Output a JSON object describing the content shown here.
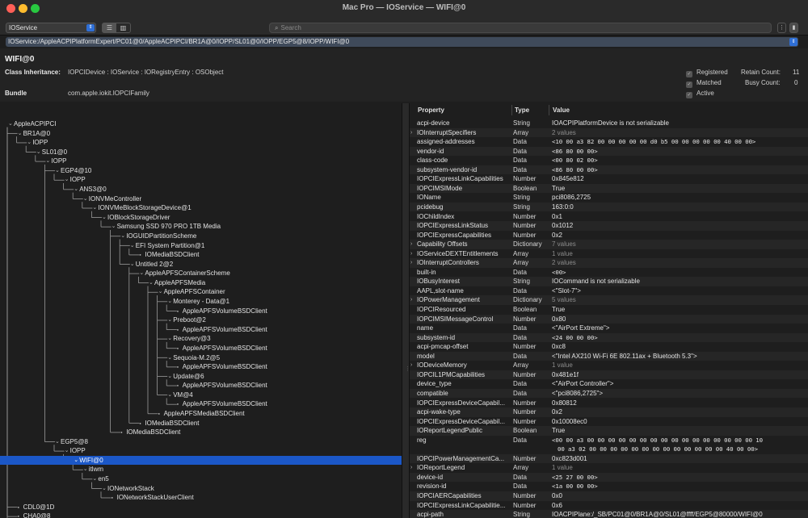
{
  "window": {
    "title": "Mac Pro — IOService — WIFI@0"
  },
  "toolbar": {
    "plane": "IOService",
    "search_placeholder": "Search"
  },
  "path": "IOService:/AppleACPIPlatformExpert/PC01@0/AppleACPIPCI/BR1A@0/IOPP/SL01@0/IOPP/EGP5@8/IOPP/WIFI@0",
  "info": {
    "name": "WIFI@0",
    "class_label": "Class Inheritance:",
    "class_value": "IOPCIDevice : IOService : IORegistryEntry : OSObject",
    "bundle_label": "Bundle",
    "bundle_value": "com.apple.iokit.IOPCIFamily",
    "registered": "Registered",
    "matched": "Matched",
    "active": "Active",
    "retain_label": "Retain Count:",
    "retain_value": "11",
    "busy_label": "Busy Count:",
    "busy_value": "0"
  },
  "tree": [
    {
      "label": "AppleACPIPCI",
      "depth": 0
    },
    {
      "label": "BR1A@0",
      "depth": 1
    },
    {
      "label": "IOPP",
      "depth": 2
    },
    {
      "label": "SL01@0",
      "depth": 3
    },
    {
      "label": "IOPP",
      "depth": 4
    },
    {
      "label": "EGP4@10",
      "depth": 5
    },
    {
      "label": "IOPP",
      "depth": 6
    },
    {
      "label": "ANS3@0",
      "depth": 7
    },
    {
      "label": "IONVMeController",
      "depth": 8
    },
    {
      "label": "IONVMeBlockStorageDevice@1",
      "depth": 9
    },
    {
      "label": "IOBlockStorageDriver",
      "depth": 10
    },
    {
      "label": "Samsung SSD 970 PRO 1TB Media",
      "depth": 11
    },
    {
      "label": "IOGUIDPartitionScheme",
      "depth": 12
    },
    {
      "label": "EFI System Partition@1",
      "depth": 13
    },
    {
      "label": "IOMediaBSDClient",
      "depth": 14
    },
    {
      "label": "Untitled 2@2",
      "depth": 13
    },
    {
      "label": "AppleAPFSContainerScheme",
      "depth": 14
    },
    {
      "label": "AppleAPFSMedia",
      "depth": 15
    },
    {
      "label": "AppleAPFSContainer",
      "depth": 16
    },
    {
      "label": "Monterey - Data@1",
      "depth": 17
    },
    {
      "label": "AppleAPFSVolumeBSDClient",
      "depth": 18
    },
    {
      "label": "Preboot@2",
      "depth": 17
    },
    {
      "label": "AppleAPFSVolumeBSDClient",
      "depth": 18
    },
    {
      "label": "Recovery@3",
      "depth": 17
    },
    {
      "label": "AppleAPFSVolumeBSDClient",
      "depth": 18
    },
    {
      "label": "Sequoia-M.2@5",
      "depth": 17
    },
    {
      "label": "AppleAPFSVolumeBSDClient",
      "depth": 18
    },
    {
      "label": "Update@6",
      "depth": 17
    },
    {
      "label": "AppleAPFSVolumeBSDClient",
      "depth": 18
    },
    {
      "label": "VM@4",
      "depth": 17
    },
    {
      "label": "AppleAPFSVolumeBSDClient",
      "depth": 18
    },
    {
      "label": "AppleAPFSMediaBSDClient",
      "depth": 16
    },
    {
      "label": "IOMediaBSDClient",
      "depth": 14
    },
    {
      "label": "IOMediaBSDClient",
      "depth": 12
    },
    {
      "label": "EGP5@8",
      "depth": 5
    },
    {
      "label": "IOPP",
      "depth": 6
    },
    {
      "label": "WIFI@0",
      "depth": 7,
      "selected": true
    },
    {
      "label": "itlwm",
      "depth": 8
    },
    {
      "label": "en5",
      "depth": 9
    },
    {
      "label": "IONetworkStack",
      "depth": 10
    },
    {
      "label": "IONetworkStackUserClient",
      "depth": 11
    },
    {
      "label": "CDL0@1D",
      "depth": 1
    },
    {
      "label": "CHA0@8",
      "depth": 1
    }
  ],
  "props": {
    "headers": {
      "property": "Property",
      "type": "Type",
      "value": "Value"
    },
    "rows": [
      {
        "k": "acpi-device",
        "t": "String",
        "v": "IOACPIPlatformDevice is not serializable"
      },
      {
        "k": "IOInterruptSpecifiers",
        "t": "Array",
        "v": "2 values",
        "exp": true,
        "dim": true
      },
      {
        "k": "assigned-addresses",
        "t": "Data",
        "v": "<10 00 a3 82 00 00 00 00 00 d0 b5 00 00 00 00 00 40 00 00>",
        "mono": true
      },
      {
        "k": "vendor-id",
        "t": "Data",
        "v": "<86 80 00 00>",
        "mono": true
      },
      {
        "k": "class-code",
        "t": "Data",
        "v": "<00 80 02 00>",
        "mono": true
      },
      {
        "k": "subsystem-vendor-id",
        "t": "Data",
        "v": "<86 80 00 00>",
        "mono": true
      },
      {
        "k": "IOPCIExpressLinkCapabilities",
        "t": "Number",
        "v": "0x845e812"
      },
      {
        "k": "IOPCIMSIMode",
        "t": "Boolean",
        "v": "True"
      },
      {
        "k": "IOName",
        "t": "String",
        "v": "pci8086,2725"
      },
      {
        "k": "pcidebug",
        "t": "String",
        "v": "163:0:0"
      },
      {
        "k": "IOChildIndex",
        "t": "Number",
        "v": "0x1"
      },
      {
        "k": "IOPCIExpressLinkStatus",
        "t": "Number",
        "v": "0x1012"
      },
      {
        "k": "IOPCIExpressCapabilities",
        "t": "Number",
        "v": "0x2"
      },
      {
        "k": "Capability Offsets",
        "t": "Dictionary",
        "v": "7 values",
        "exp": true,
        "dim": true
      },
      {
        "k": "IOServiceDEXTEntitlements",
        "t": "Array",
        "v": "1 value",
        "exp": true,
        "dim": true
      },
      {
        "k": "IOInterruptControllers",
        "t": "Array",
        "v": "2 values",
        "exp": true,
        "dim": true
      },
      {
        "k": "built-in",
        "t": "Data",
        "v": "<00>",
        "mono": true
      },
      {
        "k": "IOBusyInterest",
        "t": "String",
        "v": "IOCommand is not serializable"
      },
      {
        "k": "AAPL,slot-name",
        "t": "Data",
        "v": "<\"Slot-7\">"
      },
      {
        "k": "IOPowerManagement",
        "t": "Dictionary",
        "v": "5 values",
        "exp": true,
        "dim": true
      },
      {
        "k": "IOPCIResourced",
        "t": "Boolean",
        "v": "True"
      },
      {
        "k": "IOPCIMSIMessageControl",
        "t": "Number",
        "v": "0x80"
      },
      {
        "k": "name",
        "t": "Data",
        "v": "<\"AirPort Extreme\">"
      },
      {
        "k": "subsystem-id",
        "t": "Data",
        "v": "<24 00 00 00>",
        "mono": true
      },
      {
        "k": "acpi-pmcap-offset",
        "t": "Number",
        "v": "0xc8"
      },
      {
        "k": "model",
        "t": "Data",
        "v": "<\"Intel AX210 Wi-Fi 6E 802.11ax + Bluetooth 5.3\">"
      },
      {
        "k": "IODeviceMemory",
        "t": "Array",
        "v": "1 value",
        "exp": true,
        "dim": true
      },
      {
        "k": "IOPCIL1PMCapabilities",
        "t": "Number",
        "v": "0x481e1f"
      },
      {
        "k": "device_type",
        "t": "Data",
        "v": "<\"AirPort Controller\">"
      },
      {
        "k": "compatible",
        "t": "Data",
        "v": "<\"pci8086,2725\">"
      },
      {
        "k": "IOPCIExpressDeviceCapabil...",
        "t": "Number",
        "v": "0x80812"
      },
      {
        "k": "acpi-wake-type",
        "t": "Number",
        "v": "0x2"
      },
      {
        "k": "IOPCIExpressDeviceCapabil...",
        "t": "Number",
        "v": "0x10008ec0"
      },
      {
        "k": "IOReportLegendPublic",
        "t": "Boolean",
        "v": "True"
      },
      {
        "k": "reg",
        "t": "Data",
        "v": "<00 00 a3 00 00 00 00 00 00 00 00 00 00 00 00 00 00 00 00 10",
        "v2": "00 a3 02 00 00 00 00 00 00 00 00 00 00 00 00 00 40 00 00>",
        "mono": true,
        "tall": true
      },
      {
        "k": "IOPCIPowerManagementCa...",
        "t": "Number",
        "v": "0xc823d001"
      },
      {
        "k": "IOReportLegend",
        "t": "Array",
        "v": "1 value",
        "exp": true,
        "dim": true
      },
      {
        "k": "device-id",
        "t": "Data",
        "v": "<25 27 00 00>",
        "mono": true
      },
      {
        "k": "revision-id",
        "t": "Data",
        "v": "<1a 00 00 00>",
        "mono": true
      },
      {
        "k": "IOPCIAERCapabilities",
        "t": "Number",
        "v": "0x0"
      },
      {
        "k": "IOPCIExpressLinkCapabilitie...",
        "t": "Number",
        "v": "0x6"
      },
      {
        "k": "acpi-path",
        "t": "String",
        "v": "IOACPIPlane:/_SB/PC01@0/BR1A@0/SL01@ffff/EGP5@80000/WIFI@0"
      }
    ]
  }
}
